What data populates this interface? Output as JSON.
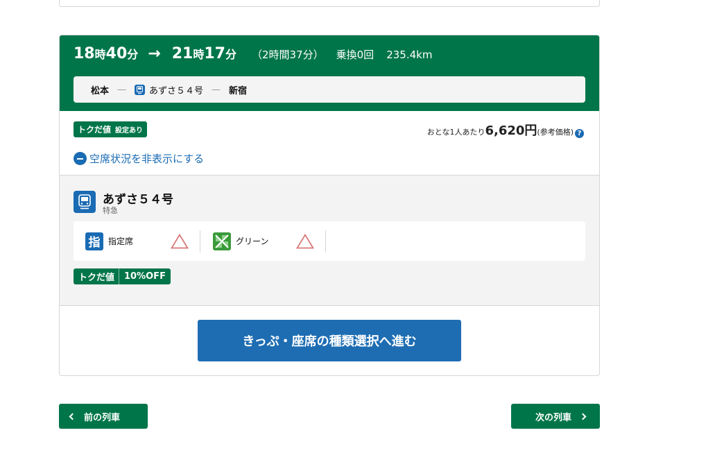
{
  "itinerary": {
    "depart": {
      "hour": "18",
      "hour_unit": "時",
      "minute": "40",
      "minute_unit": "分"
    },
    "arrow": "→",
    "arrive": {
      "hour": "21",
      "hour_unit": "時",
      "minute": "17",
      "minute_unit": "分"
    },
    "duration": "（2時間37分）",
    "transfers": "乗換0回",
    "distance": "235.4km"
  },
  "route": {
    "from": "松本",
    "dash": "—",
    "train": "あずさ５４号",
    "to": "新宿"
  },
  "summary": {
    "tokudane_tag": "トクだ値",
    "tokudane_sub": "設定あり",
    "price_prefix": "おとな1人あたり",
    "price_amount": "6,620円",
    "price_note": "(参考価格)",
    "help_glyph": "?",
    "toggle_label": "空席状況を非表示にする"
  },
  "train": {
    "name": "あずさ５４号",
    "type": "特急",
    "seats": [
      {
        "icon_char": "指",
        "label": "指定席",
        "availability": "triangle"
      },
      {
        "icon_char": "",
        "label": "グリーン",
        "availability": "triangle"
      }
    ],
    "discount_label": "トクだ値",
    "discount_value": "10%OFF"
  },
  "actions": {
    "proceed_label": "きっぷ・座席の種類選択へ進む",
    "prev_label": "前の列車",
    "next_label": "次の列車"
  },
  "icons": {
    "train": "train-icon",
    "help": "help-icon",
    "collapse": "minus-circle-icon",
    "availability": "triangle-icon",
    "green_car": "clover-icon"
  },
  "colors": {
    "brand_green": "#00754a",
    "accent_blue": "#1e6db3",
    "triangle_red": "#d97a7a"
  }
}
